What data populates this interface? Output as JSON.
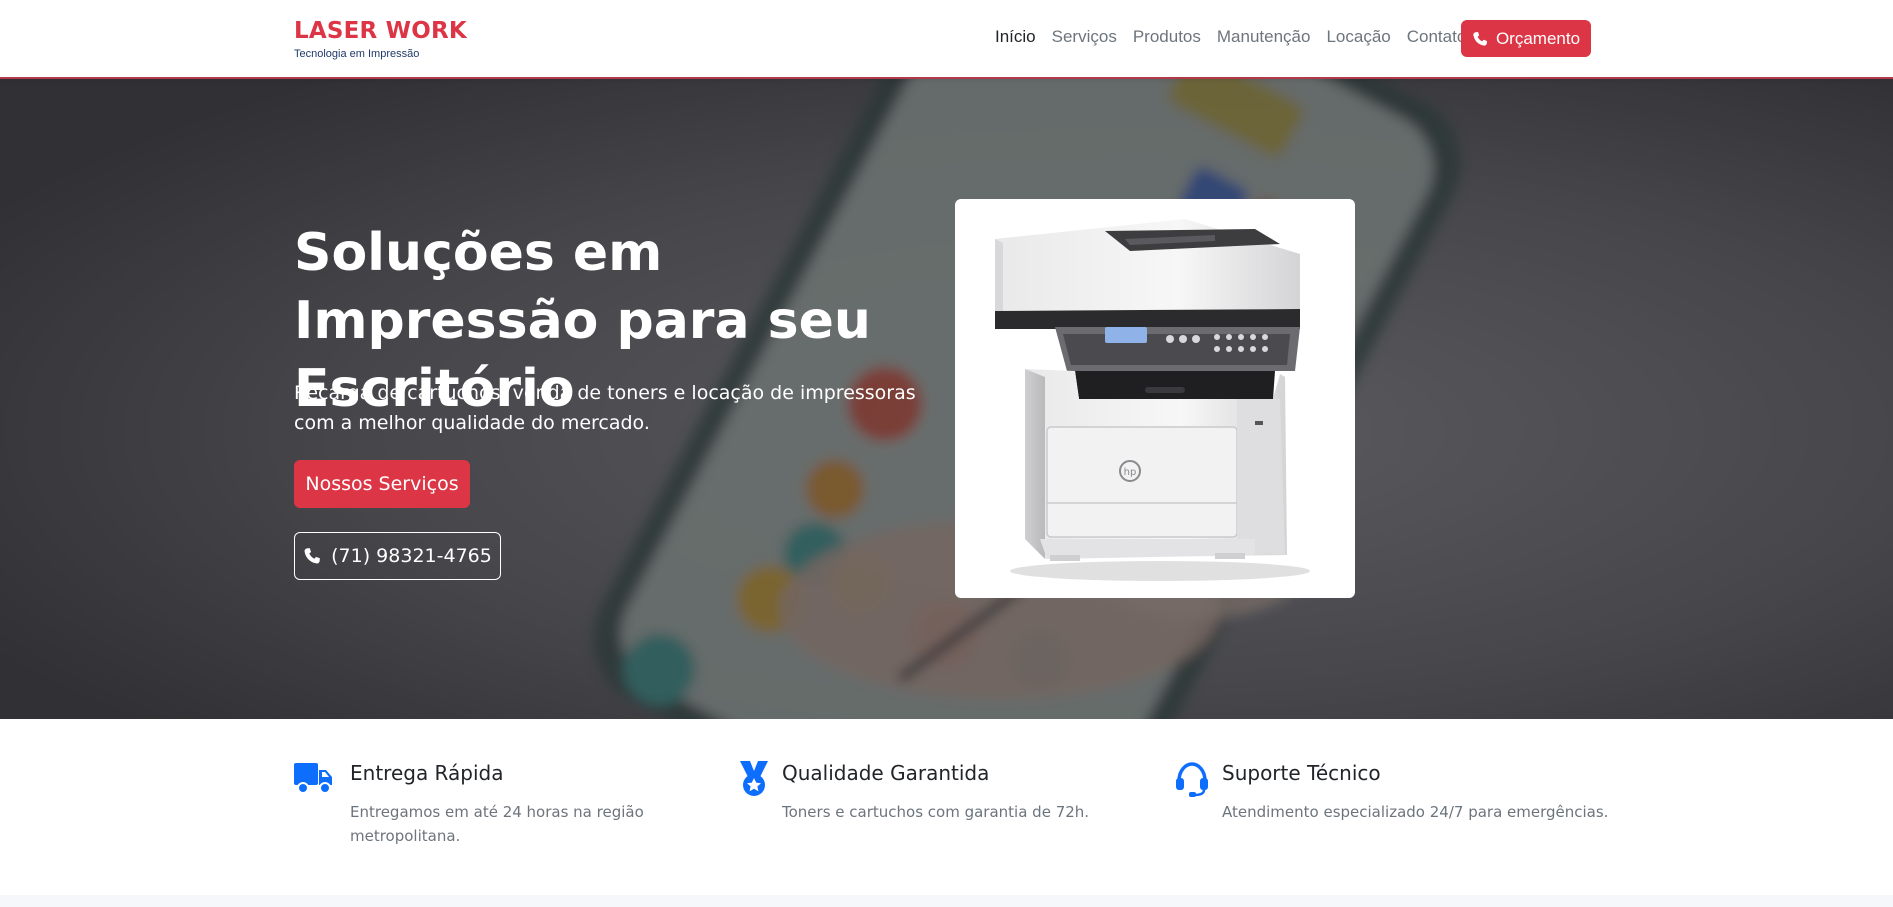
{
  "navbar": {
    "brand_name": "LASER WORK",
    "brand_tagline": "Tecnologia em Impressão",
    "links": [
      "Início",
      "Serviços",
      "Produtos",
      "Manutenção",
      "Locação",
      "Contato"
    ],
    "active_link": "Início",
    "quote_button": {
      "label": "Orçamento",
      "icon": "phone-icon"
    }
  },
  "hero": {
    "title": "Soluções em Impressão para seu Escritório",
    "subtitle": "Recarga de cartuchos, venda de toners e locação de impressoras com a melhor qualidade do mercado.",
    "primary_button": "Nossos Serviços",
    "phone_button": {
      "label": "(71) 98321-4765",
      "icon": "phone-icon"
    },
    "image_icon": "printer-image"
  },
  "features": [
    {
      "icon": "truck-icon",
      "title": "Entrega Rápida",
      "description": "Entregamos em até 24 horas na região metropolitana."
    },
    {
      "icon": "award-medal-icon",
      "title": "Qualidade Garantida",
      "description": "Toners e cartuchos com garantia de 72h."
    },
    {
      "icon": "headset-icon",
      "title": "Suporte Técnico",
      "description": "Atendimento especializado 24/7 para emergências."
    }
  ],
  "colors": {
    "brand_red": "#dc3545",
    "tagline_navy": "#1f3a68",
    "feature_icon_blue": "#0d6efd",
    "hero_overlay": "#3a3a3e"
  }
}
